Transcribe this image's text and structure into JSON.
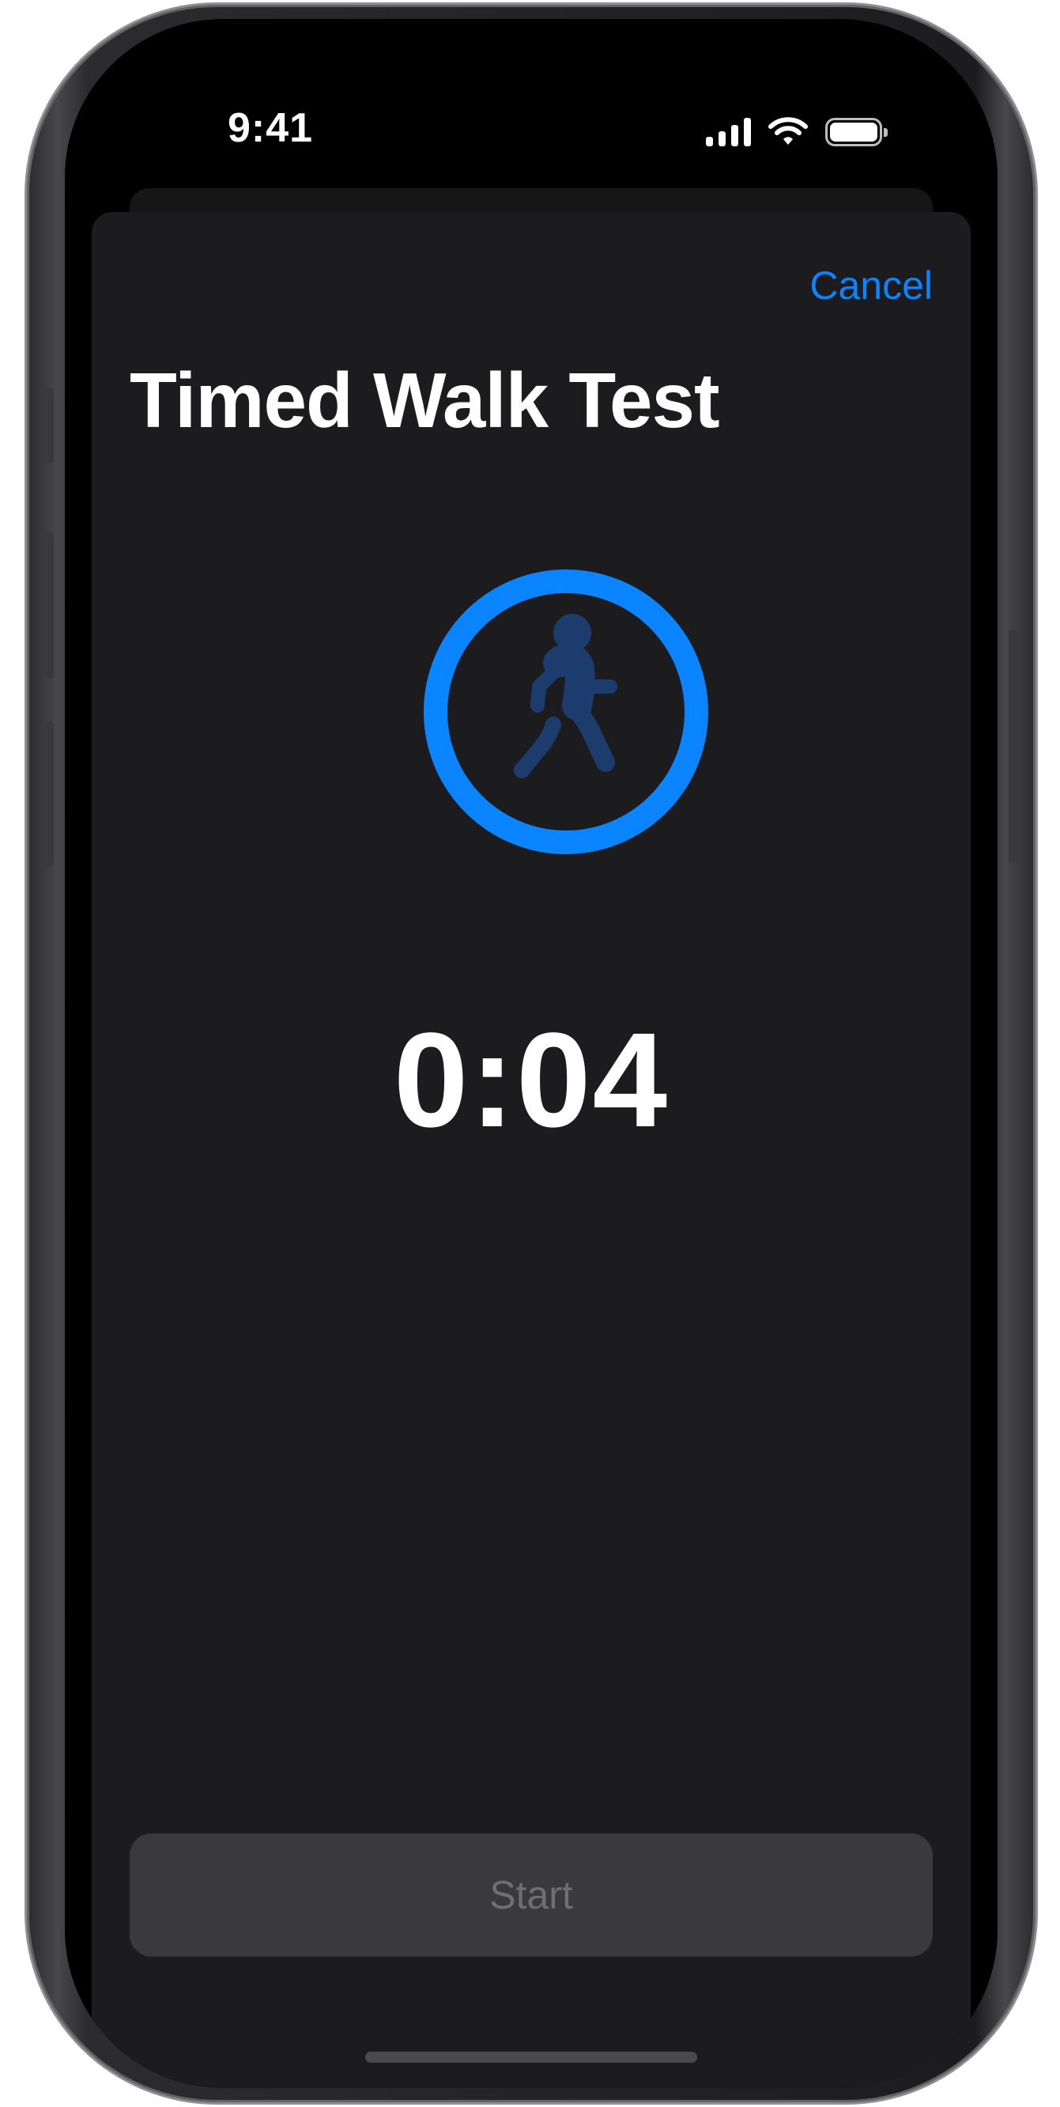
{
  "status_bar": {
    "time": "9:41",
    "icons": [
      "cellular-signal-icon",
      "wifi-icon",
      "battery-icon"
    ]
  },
  "nav": {
    "cancel_label": "Cancel"
  },
  "page": {
    "title": "Timed Walk Test"
  },
  "activity": {
    "icon": "figure-walk-icon",
    "timer": "0:04"
  },
  "actions": {
    "start_label": "Start",
    "start_enabled": false
  },
  "colors": {
    "accent": "#0a84ff",
    "figure": "#1c3c6e",
    "sheet_background": "#1c1c1e",
    "disabled_button": "#3a3a3c",
    "disabled_text": "#6e6e73"
  }
}
